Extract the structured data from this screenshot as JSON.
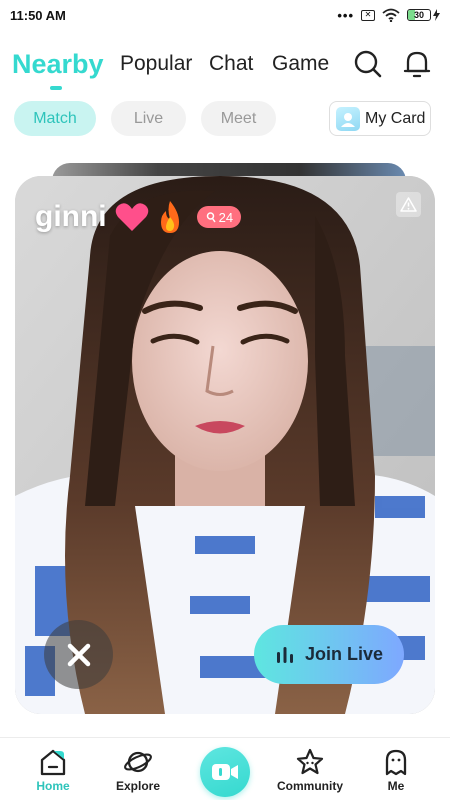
{
  "status_bar": {
    "time": "11:50 AM",
    "dots": "•••",
    "sim": "✕",
    "battery": "30",
    "battery_level": 0.3
  },
  "top_nav": {
    "tabs": [
      {
        "label": "Nearby",
        "active": true
      },
      {
        "label": "Popular",
        "active": false
      },
      {
        "label": "Chat",
        "active": false
      },
      {
        "label": "Game",
        "active": false
      }
    ],
    "icons": [
      "search-icon",
      "bell-icon"
    ]
  },
  "sub_filter": {
    "pills": [
      {
        "label": "Match",
        "active": true
      },
      {
        "label": "Live",
        "active": false
      },
      {
        "label": "Meet",
        "active": false
      }
    ],
    "my_card_label": "My Card"
  },
  "card": {
    "name": "ginni",
    "view_count": "24",
    "join_label": "Join Live",
    "icons": [
      "heart-icon",
      "flame-icon",
      "person-icon",
      "warning-icon",
      "close-icon",
      "audio-bars-icon"
    ]
  },
  "bottom_nav": {
    "items": [
      {
        "label": "Home",
        "icon": "home-icon",
        "active": true
      },
      {
        "label": "Explore",
        "icon": "planet-icon",
        "active": false
      },
      {
        "label": "Community",
        "icon": "star-icon",
        "active": false
      },
      {
        "label": "Me",
        "icon": "ghost-icon",
        "active": false
      }
    ],
    "center_icon": "video-icon"
  },
  "colors": {
    "accent": "#35d9cf",
    "accent_light": "#c9f4f1",
    "badge": "#ff6f7f",
    "join_gradient_start": "#5ee6e0",
    "join_gradient_end": "#7ea8ff"
  }
}
